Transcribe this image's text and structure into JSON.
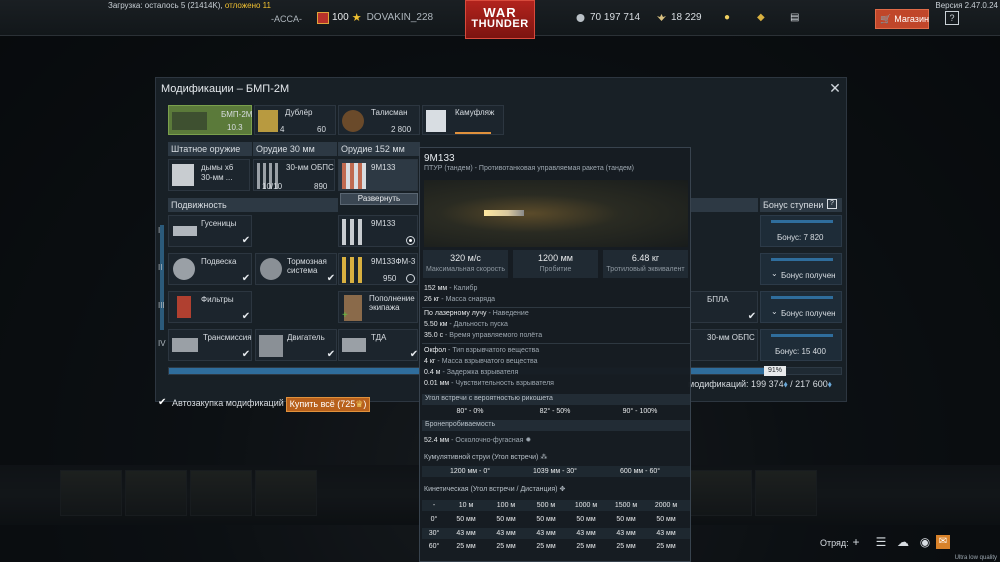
{
  "topbar": {
    "loading_prefix": "Загрузка: осталось 5 (21414K), ",
    "loading_deferred": "отложено 11",
    "version": "Версия 2.47.0.24",
    "squad_tag": "-ACCA-",
    "rank": "100",
    "nick": "DOVAKIN_228",
    "logo_line1": "WAR",
    "logo_line2": "THUNDER",
    "silver": "70 197 714",
    "research": "18 229",
    "shop": "Магазин",
    "help": "?"
  },
  "modal": {
    "title": "Модификации – БМП-2М",
    "close": "✕",
    "top_row": {
      "vehicle_name": "БМП-2М",
      "vehicle_br": "10.3",
      "duplicate": "Дублёр",
      "duplicate_count": "4",
      "duplicate_price": "60",
      "talisman": "Талисман",
      "talisman_price": "2 800",
      "camo": "Камуфляж"
    },
    "weapons": {
      "standard_head": "Штатное оружие",
      "gun30_head": "Орудие 30 мм",
      "gun152_head": "Орудие 152 мм",
      "smoke": "дымы х6",
      "smoke_sub": "30-мм ...",
      "ap30": "30-мм ОБПС",
      "ap30_count": "10/10",
      "ap30_price": "890",
      "m9m133_top": "9М133",
      "expand_btn": "Развернуть"
    },
    "mobility": {
      "head": "Подвижность",
      "tracks": "Гусеницы",
      "suspension": "Подвеска",
      "brakes": "Тормозная система",
      "filters": "Фильтры",
      "transmission": "Трансмиссия",
      "engine": "Двигатель"
    },
    "missiles": {
      "m9m133": "9М133",
      "m9m133fm3": "9М133ФМ-3",
      "m9m133fm3_price": "950",
      "crew_refill": "Пополнение экипажа",
      "tda": "ТДА"
    },
    "right_partial": {
      "bpla": "БПЛА",
      "ap30_right": "30-мм ОБПС"
    },
    "tiers": [
      "I",
      "II",
      "III",
      "IV"
    ],
    "bonus": {
      "head": "Бонус ступени",
      "help": "?",
      "tier1": "Бонус: 7 820",
      "tier2": "Бонус получен",
      "tier3": "Бонус получен",
      "tier4": "Бонус: 15 400"
    },
    "progress": {
      "fraction": 0.91,
      "label": "91%"
    },
    "total_prefix": "модификаций: 199 374",
    "total_sep": " / ",
    "total_max": "217 600",
    "autobuy_label": "Автозакупка модификаций",
    "buy_all": "Купить всё (725",
    "buy_all_close": ")"
  },
  "tooltip": {
    "name": "9М133",
    "desc": "ПТУР (тандем) - Противотанковая управляемая ракета (тандем)",
    "stats": [
      {
        "value": "320 м/с",
        "label": "Максимальная скорость"
      },
      {
        "value": "1200 мм",
        "label": "Пробитие"
      },
      {
        "value": "6.48 кг",
        "label": "Тротиловый эквивалент"
      }
    ],
    "props1": [
      {
        "v": "152 мм",
        "l": " - Калибр"
      },
      {
        "v": "26 кг",
        "l": " - Масса снаряда"
      }
    ],
    "props2": [
      {
        "v": "По лазерному лучу",
        "l": " - Наведение"
      },
      {
        "v": "5.50 км",
        "l": " - Дальность пуска"
      },
      {
        "v": "35.0 с",
        "l": " - Время управляемого полёта"
      }
    ],
    "props3": [
      {
        "v": "Окфол",
        "l": " - Тип взрывчатого вещества"
      },
      {
        "v": "4 кг",
        "l": " - Масса взрывчатого вещества"
      },
      {
        "v": "0.4 м",
        "l": " - Задержка взрывателя"
      },
      {
        "v": "0.01 мм",
        "l": " - Чувствительность взрывателя"
      }
    ],
    "ricochet_head": "Угол встречи с вероятностью рикошета",
    "ricochet": [
      "80° - 0%",
      "82° - 50%",
      "90° - 100%"
    ],
    "armor_head": "Бронепробиваемость",
    "he_line_v": "52.4 мм",
    "he_line_l": " - Осколочно-фугасная",
    "cumul_head": "Кумулятивной струи (Угол встречи)",
    "cumul": [
      "1200 мм - 0°",
      "1039 мм - 30°",
      "600 мм - 60°"
    ],
    "kinetic_head": "Кинетическая (Угол встречи / Дистанция)",
    "kinetic_cols": [
      "-",
      "10 м",
      "100 м",
      "500 м",
      "1000 м",
      "1500 м",
      "2000 м"
    ],
    "kinetic_rows": [
      [
        "0°",
        "50 мм",
        "50 мм",
        "50 мм",
        "50 мм",
        "50 мм",
        "50 мм"
      ],
      [
        "30°",
        "43 мм",
        "43 мм",
        "43 мм",
        "43 мм",
        "43 мм",
        "43 мм"
      ],
      [
        "60°",
        "25 мм",
        "25 мм",
        "25 мм",
        "25 мм",
        "25 мм",
        "25 мм"
      ]
    ]
  },
  "bottombar": {
    "squad_label": "Отряд:",
    "quality": "Ultra low quality"
  },
  "icons": {
    "accent_orange": "#c0462a",
    "gold": "#f0c030",
    "progress_blue": "#2f6d9c"
  }
}
